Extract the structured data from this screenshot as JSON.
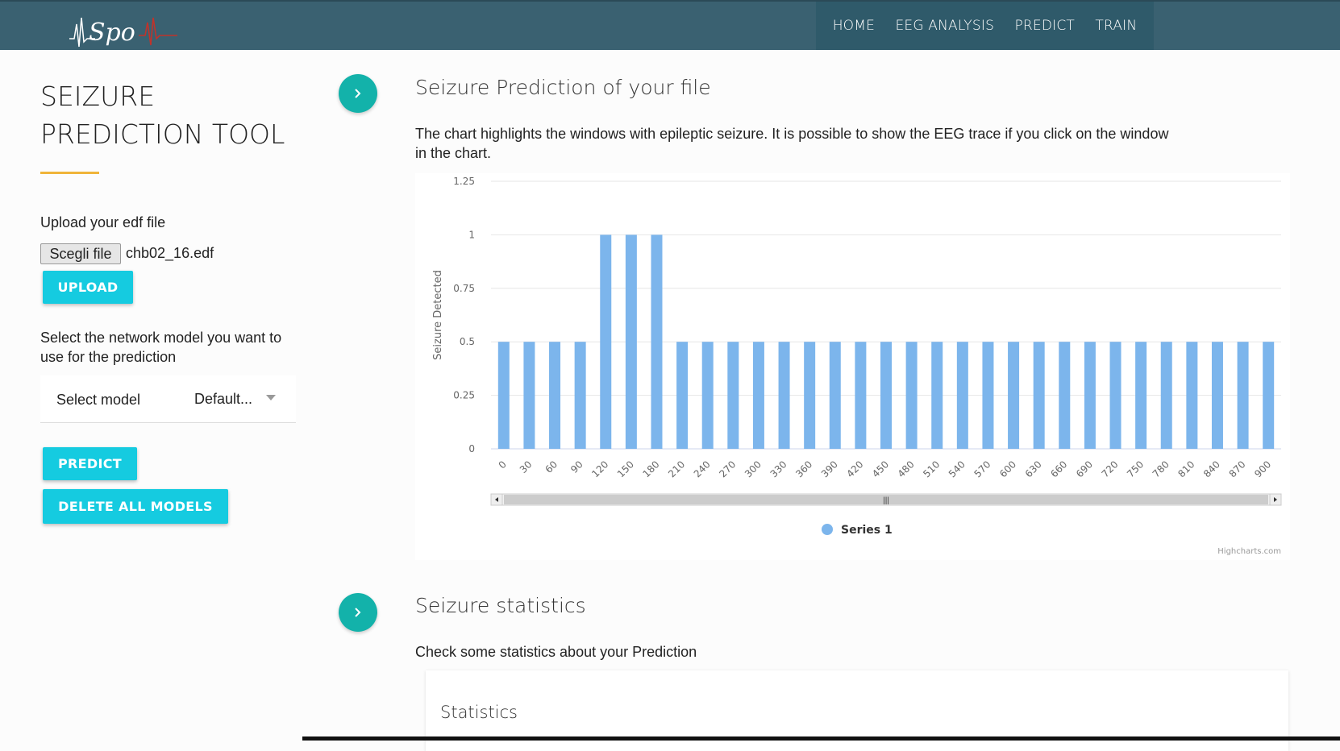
{
  "nav": {
    "logo_text": "Spo",
    "items": [
      "HOME",
      "EEG ANALYSIS",
      "PREDICT",
      "TRAIN"
    ]
  },
  "sidebar": {
    "title_line1": "SEIZURE",
    "title_line2": "PREDICTION TOOL",
    "upload_label": "Upload your edf file",
    "file_button": "Scegli file",
    "file_name": "chb02_16.edf",
    "upload_button": "UPLOAD",
    "model_label": "Select the network model you want to use for the prediction",
    "select_label": "Select model",
    "select_value": "Default...",
    "predict_button": "PREDICT",
    "delete_button": "DELETE ALL MODELS"
  },
  "prediction": {
    "title": "Seizure Prediction of your file",
    "description": "The chart highlights the windows with epileptic seizure. It is possible to show the EEG trace if you click on the window in the chart."
  },
  "statistics": {
    "title": "Seizure statistics",
    "description": "Check some statistics about your Prediction",
    "card_title": "Statistics"
  },
  "chart_data": {
    "type": "bar",
    "ylabel": "Seizure Detected",
    "ylim": [
      0,
      1.25
    ],
    "yticks": [
      "0",
      "0.25",
      "0.5",
      "0.75",
      "1",
      "1.25"
    ],
    "categories": [
      "0",
      "30",
      "60",
      "90",
      "120",
      "150",
      "180",
      "210",
      "240",
      "270",
      "300",
      "330",
      "360",
      "390",
      "420",
      "450",
      "480",
      "510",
      "540",
      "570",
      "600",
      "630",
      "660",
      "690",
      "720",
      "750",
      "780",
      "810",
      "840",
      "870",
      "900"
    ],
    "series": [
      {
        "name": "Series 1",
        "color": "#7cb5ec",
        "values": [
          0.5,
          0.5,
          0.5,
          0.5,
          1,
          1,
          1,
          0.5,
          0.5,
          0.5,
          0.5,
          0.5,
          0.5,
          0.5,
          0.5,
          0.5,
          0.5,
          0.5,
          0.5,
          0.5,
          0.5,
          0.5,
          0.5,
          0.5,
          0.5,
          0.5,
          0.5,
          0.5,
          0.5,
          0.5,
          0.5
        ]
      }
    ],
    "legend": "bottom-center",
    "credits": "Highcharts.com",
    "grid": true
  }
}
